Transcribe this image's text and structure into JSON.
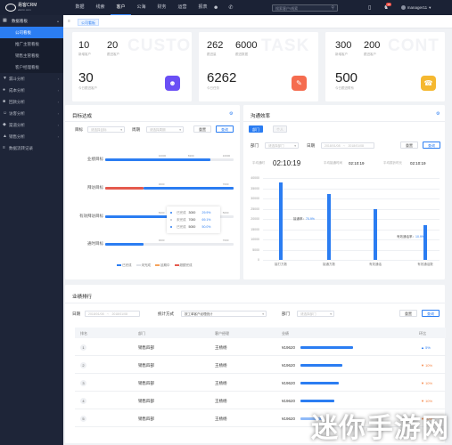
{
  "app": {
    "logo_line1": "易客CRM",
    "logo_line2": "ekcrm.com"
  },
  "topnav": [
    "数据",
    "线索",
    "客户",
    "公海",
    "财务",
    "运营",
    "报表"
  ],
  "search_placeholder": "搜索客户/线索",
  "notif_count": "10",
  "user_name": "manager11",
  "sidebar": {
    "group": "数据看板",
    "sub_items": [
      "公司看板",
      "推广主管看板",
      "销售主管看板",
      "客户经理看板"
    ],
    "items": [
      "漏斗分析",
      "成本分析",
      "回款分析",
      "访客分析",
      "渠道分析",
      "销售分析",
      "数据流转记录"
    ]
  },
  "tab_label": "公司看板",
  "kpi": [
    {
      "v1": "10",
      "l1": "新增客户",
      "v2": "20",
      "l2": "跟进客户",
      "big": "30",
      "big_label": "今日跟进客户",
      "watermark": "CUSTO",
      "color": "#6a4ff5",
      "icon": "user-icon"
    },
    {
      "v1": "262",
      "l1": "跟进量",
      "v2": "6000",
      "l2": "跟进数据",
      "big": "6262",
      "big_label": "今日任务",
      "watermark": "TASK",
      "color": "#f56c4f",
      "icon": "task-icon"
    },
    {
      "v1": "300",
      "l1": "新增客户",
      "v2": "200",
      "l2": "跟进客户",
      "big": "500",
      "big_label": "今日跟进联系",
      "watermark": "CONT",
      "color": "#f5b830",
      "icon": "contact-icon"
    }
  ],
  "target": {
    "title": "目标达成",
    "f1_label": "目标",
    "f1_placeholder": "请选择目标",
    "f2_label": "周期",
    "f2_placeholder": "请选择周期",
    "reset": "重置",
    "query": "查询",
    "tooltip": [
      {
        "name": "已完成",
        "value": "3000",
        "pct": "29.9%"
      },
      {
        "name": "未完成",
        "value": "7000",
        "pct": "69.1%"
      },
      {
        "name": "已完成",
        "value": "5000",
        "pct": "50.0%"
      }
    ],
    "legend": [
      "已完成",
      "未完成",
      "延期中",
      "超额完成"
    ]
  },
  "chart_data": [
    {
      "type": "bar",
      "orientation": "horizontal",
      "categories": [
        "业绩目标",
        "拜访目标",
        "有效拜访目标",
        "通时目标"
      ],
      "series": [
        {
          "name": "已完成",
          "values": [
            8200,
            3000,
            5000,
            3000
          ]
        },
        {
          "name": "未完成",
          "values": [
            1800,
            7000,
            5000,
            7000
          ]
        }
      ],
      "top_labels": [
        [
          "10000",
          "8200",
          "10000"
        ],
        [
          "3000",
          "",
          "7000"
        ],
        [
          "5000",
          "",
          "5000"
        ],
        [
          "3000",
          "",
          "7000"
        ]
      ],
      "xlim": [
        0,
        10000
      ]
    },
    {
      "type": "bar",
      "categories": [
        "接打方数",
        "接通方数",
        "有效通话",
        "有效通话数"
      ],
      "values": [
        38000,
        32000,
        25000,
        17000
      ],
      "annotations": [
        {
          "label": "接通率",
          "value": "70.9%"
        },
        {
          "label": "有效通话率",
          "value": "10.9%"
        }
      ],
      "yticks": [
        "40000",
        "35000",
        "30000",
        "25000",
        "20000",
        "15000",
        "10000",
        "5000",
        "0"
      ],
      "ylim": [
        0,
        40000
      ]
    }
  ],
  "comm": {
    "title": "沟通效率",
    "tabs": [
      "部门",
      "个人"
    ],
    "f1_label": "部门",
    "f1_placeholder": "请选择部门",
    "f2_label": "日期",
    "date_from": "2018/01/08",
    "date_to": "2018/01/08",
    "reset": "重置",
    "query": "查询",
    "m1_label": "平均通时",
    "m1_value": "02:10:19",
    "m2_label": "平均接通时间",
    "m2_value": "02:10:19",
    "m3_label": "平均振铃时长",
    "m3_value": "02:10:19"
  },
  "rank": {
    "title": "业绩排行",
    "date_label": "日期",
    "date_from": "2018/01/08",
    "date_to": "2018/01/08",
    "stat_label": "统计方式",
    "stat_value": "按工单客户经理统计",
    "dept_label": "部门",
    "dept_placeholder": "请选择部门",
    "reset": "重置",
    "query": "查询",
    "headers": [
      "排名",
      "部门",
      "客户经理",
      "业绩",
      "环比"
    ],
    "rows": [
      {
        "rank": "1",
        "dept": "销售四部",
        "mgr": "王杨杨",
        "amount": "¥19620",
        "change": "5%",
        "dir": "up",
        "bar": 0.95
      },
      {
        "rank": "2",
        "dept": "销售四部",
        "mgr": "王杨杨",
        "amount": "¥19620",
        "change": "10%",
        "dir": "down",
        "bar": 0.75
      },
      {
        "rank": "3",
        "dept": "销售四部",
        "mgr": "王杨杨",
        "amount": "¥19620",
        "change": "10%",
        "dir": "down",
        "bar": 0.7
      },
      {
        "rank": "4",
        "dept": "销售四部",
        "mgr": "王杨杨",
        "amount": "¥19620",
        "change": "10%",
        "dir": "down",
        "bar": 0.62
      },
      {
        "rank": "5",
        "dept": "销售四部",
        "mgr": "王杨杨",
        "amount": "¥19620",
        "change": "10%",
        "dir": "down",
        "bar": 0.4
      }
    ]
  },
  "watermark": "迷你手游网"
}
